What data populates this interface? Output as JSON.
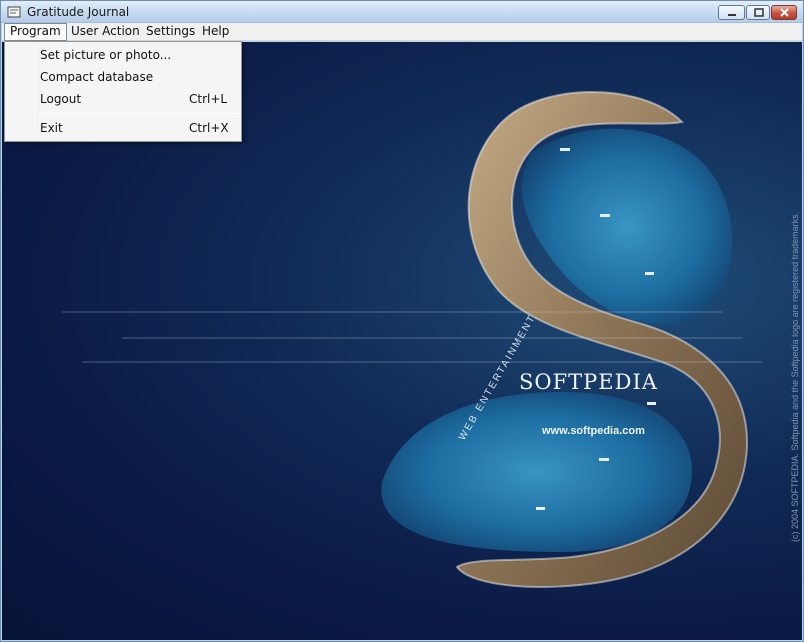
{
  "window": {
    "title": "Gratitude Journal"
  },
  "menubar": {
    "items": [
      {
        "label": "Program"
      },
      {
        "label": "User Action"
      },
      {
        "label": "Settings"
      },
      {
        "label": "Help"
      }
    ]
  },
  "program_menu": {
    "items": [
      {
        "label": "Set picture or photo...",
        "shortcut": ""
      },
      {
        "label": "Compact database",
        "shortcut": ""
      },
      {
        "label": "Logout",
        "shortcut": "Ctrl+L"
      },
      {
        "label": "Exit",
        "shortcut": "Ctrl+X"
      }
    ]
  },
  "background": {
    "brand_name": "SOFTPEDIA",
    "brand_url": "www.softpedia.com",
    "tagline": "WEB ENTERTAINMENT",
    "copyright": "(c) 2004 SOFTPEDIA. Softpedia and the Softpedia logo are registered trademarks."
  },
  "colors": {
    "ocean": "#0a1a45",
    "rock": "#8b7355",
    "lagoon": "#1d6fa3"
  }
}
